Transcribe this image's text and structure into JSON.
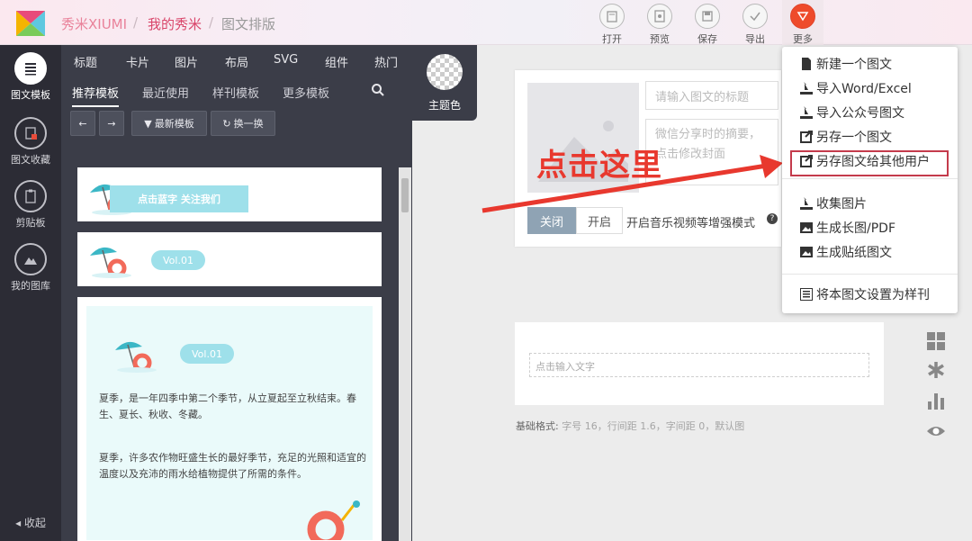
{
  "header": {
    "breadcrumb": [
      "秀米XIUMI",
      "我的秀米",
      "图文排版"
    ],
    "buttons": [
      {
        "label": "打开",
        "icon": "folder-icon"
      },
      {
        "label": "预览",
        "icon": "preview-icon"
      },
      {
        "label": "保存",
        "icon": "save-icon"
      },
      {
        "label": "导出",
        "icon": "export-check-icon"
      },
      {
        "label": "更多",
        "icon": "more-triangle-icon"
      }
    ]
  },
  "sidebar": {
    "items": [
      {
        "label": "图文模板",
        "icon": "list-icon",
        "active": true
      },
      {
        "label": "图文收藏",
        "icon": "star-doc-icon"
      },
      {
        "label": "剪贴板",
        "icon": "clipboard-icon"
      },
      {
        "label": "我的图库",
        "icon": "mountain-icon"
      }
    ],
    "collapse_label": "收起"
  },
  "panel": {
    "tabs_primary": [
      "标题",
      "卡片",
      "图片",
      "布局",
      "SVG",
      "组件",
      "热门"
    ],
    "tabs_secondary": [
      "推荐模板",
      "最近使用",
      "样刊模板",
      "更多模板"
    ],
    "active_secondary": "推荐模板",
    "tools": {
      "newest": "最新模板",
      "shuffle": "换一换"
    },
    "theme_label": "主题色",
    "cards": [
      {
        "banner": "点击蓝字 关注我们"
      },
      {
        "badge": "Vol.01"
      },
      {
        "badge": "Vol.01",
        "paragraphs": [
          "夏季，是一年四季中第二个季节，从立夏起至立秋结束。春生、夏长、秋收、冬藏。",
          "夏季，许多农作物旺盛生长的最好季节，充足的光照和适宜的温度以及充沛的雨水给植物提供了所需的条件。"
        ]
      }
    ]
  },
  "editor": {
    "title_placeholder": "请输入图文的标题",
    "summary_placeholder": "微信分享时的摘要，点击修改封面",
    "toggle_off": "关闭",
    "toggle_on": "开启",
    "music_mode_text": "开启音乐视频等增强模式",
    "text_placeholder": "点击输入文字",
    "base_format_label": "基础格式:",
    "base_format_value": "字号 16，行间距 1.6，字间距 0，默认图"
  },
  "dropdown": {
    "items": [
      {
        "label": "新建一个图文",
        "icon": "new-doc-icon"
      },
      {
        "label": "导入Word/Excel",
        "icon": "import-icon"
      },
      {
        "label": "导入公众号图文",
        "icon": "import-icon"
      },
      {
        "label": "另存一个图文",
        "icon": "save-as-icon"
      },
      {
        "label": "另存图文给其他用户",
        "icon": "save-as-icon",
        "highlighted": true
      },
      {
        "label": "收集图片",
        "icon": "collect-image-icon"
      },
      {
        "label": "生成长图/PDF",
        "icon": "image-icon"
      },
      {
        "label": "生成贴纸图文",
        "icon": "image-icon"
      },
      {
        "label": "将本图文设置为样刊",
        "icon": "list-box-icon"
      }
    ]
  },
  "annotation": {
    "text": "点击这里",
    "color": "#e8382e"
  },
  "colors": {
    "accent": "#d9466a",
    "dark_panel": "#3b3d48",
    "highlight": "#c43b4c"
  }
}
